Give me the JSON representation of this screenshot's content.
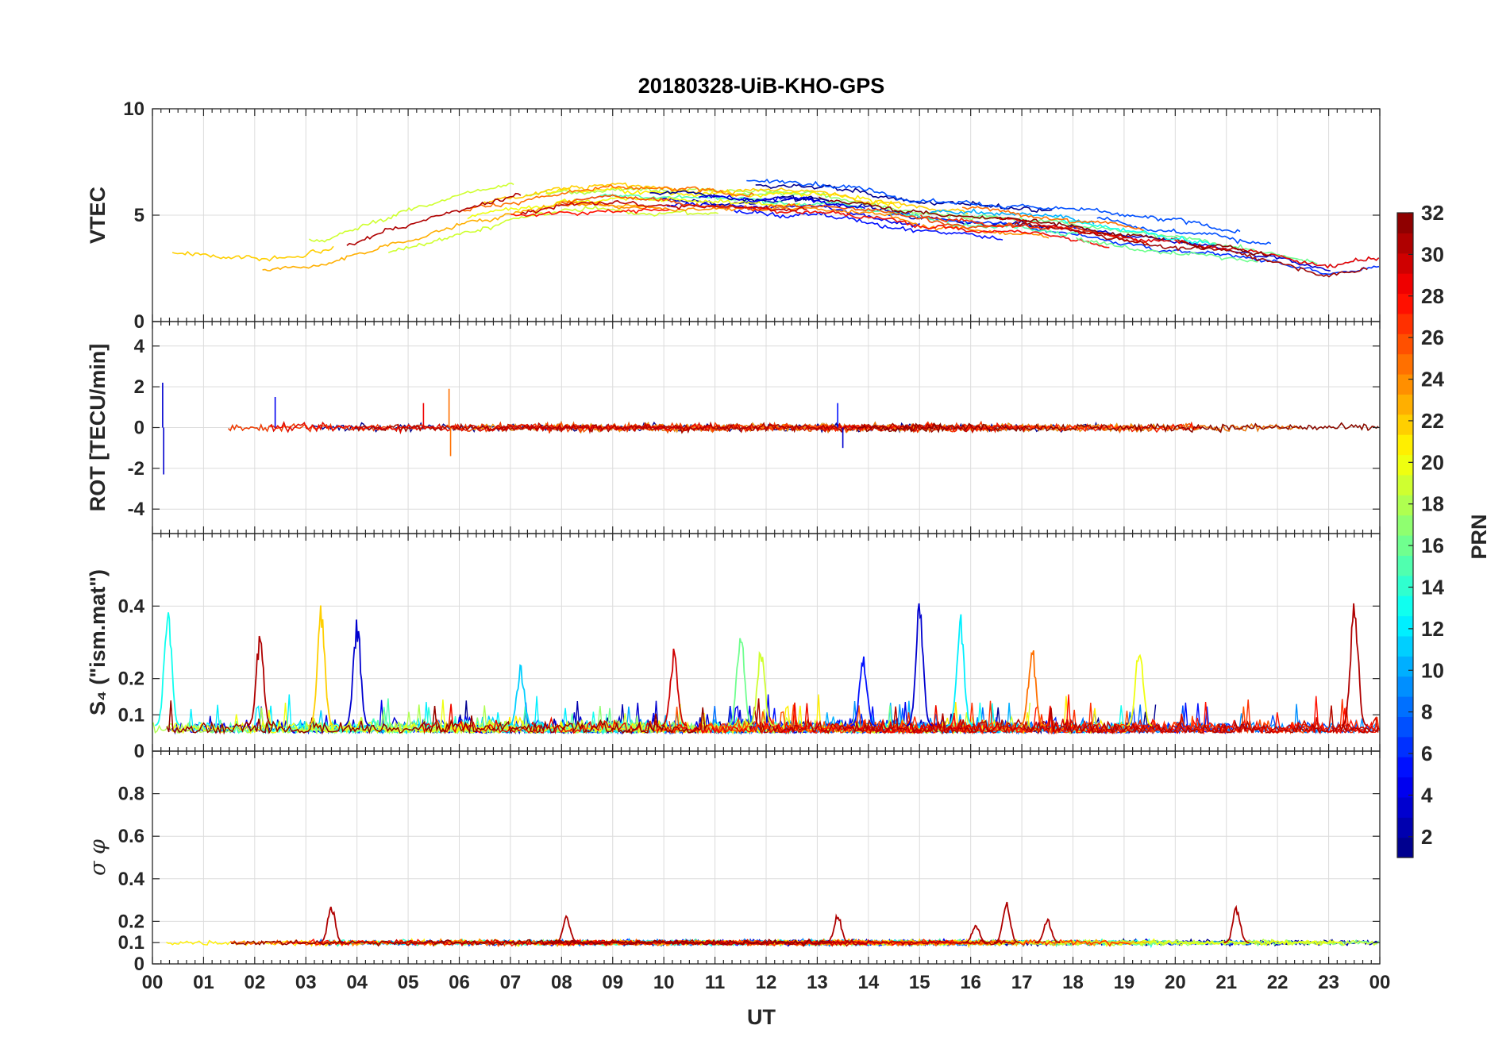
{
  "chart_data": {
    "type": "line",
    "title": "20180328-UiB-KHO-GPS",
    "xlabel": "UT",
    "x_ticks": [
      "00",
      "01",
      "02",
      "03",
      "04",
      "05",
      "06",
      "07",
      "08",
      "09",
      "10",
      "11",
      "12",
      "13",
      "14",
      "15",
      "16",
      "17",
      "18",
      "19",
      "20",
      "21",
      "22",
      "23",
      "00"
    ],
    "xlim": [
      0,
      24
    ],
    "panels": [
      {
        "id": "vtec",
        "ylabel": "VTEC",
        "ylim": [
          0,
          10
        ],
        "yticks": [
          0,
          5,
          10
        ],
        "grid": true,
        "trend_hours": [
          0,
          1,
          2,
          3,
          4,
          5,
          6,
          7,
          8,
          9,
          10,
          11,
          12,
          13,
          14,
          15,
          16,
          17,
          18,
          19,
          20,
          21,
          22,
          23,
          24
        ],
        "trend_values": [
          3.0,
          3.1,
          3.0,
          3.0,
          3.6,
          4.4,
          5.1,
          5.6,
          6.0,
          6.1,
          6.0,
          5.9,
          5.8,
          5.8,
          5.5,
          5.1,
          4.9,
          4.8,
          4.5,
          4.1,
          3.8,
          3.5,
          3.1,
          2.5,
          2.9
        ]
      },
      {
        "id": "rot",
        "ylabel": "ROT [TECU/min]",
        "ylim": [
          -5.2,
          5.2
        ],
        "yticks": [
          -4,
          -2,
          0,
          2,
          4
        ],
        "grid": true,
        "baseline": 0
      },
      {
        "id": "s4",
        "ylabel": "S₄ (\"ism.mat\")",
        "ylim": [
          0,
          0.6
        ],
        "yticks": [
          0,
          0.1,
          0.2,
          0.4
        ],
        "ytick_labels": [
          "0",
          "0.1",
          "0.2",
          "0.4"
        ],
        "grid": true,
        "baseline": 0.07,
        "peaks": [
          {
            "hour": 0.3,
            "value": 0.42,
            "prn": 13
          },
          {
            "hour": 2.1,
            "value": 0.33,
            "prn": 31
          },
          {
            "hour": 3.3,
            "value": 0.41,
            "prn": 22
          },
          {
            "hour": 4.0,
            "value": 0.38,
            "prn": 3
          },
          {
            "hour": 7.2,
            "value": 0.24,
            "prn": 11
          },
          {
            "hour": 10.2,
            "value": 0.29,
            "prn": 30
          },
          {
            "hour": 11.5,
            "value": 0.35,
            "prn": 16
          },
          {
            "hour": 11.9,
            "value": 0.3,
            "prn": 19
          },
          {
            "hour": 13.9,
            "value": 0.27,
            "prn": 5
          },
          {
            "hour": 15.0,
            "value": 0.43,
            "prn": 3
          },
          {
            "hour": 15.8,
            "value": 0.39,
            "prn": 12
          },
          {
            "hour": 17.2,
            "value": 0.3,
            "prn": 25
          },
          {
            "hour": 19.3,
            "value": 0.32,
            "prn": 20
          },
          {
            "hour": 23.5,
            "value": 0.46,
            "prn": 31
          }
        ]
      },
      {
        "id": "sigma_phi",
        "ylabel": "σ φ",
        "ylim": [
          0,
          1
        ],
        "yticks": [
          0,
          0.1,
          0.2,
          0.4,
          0.6,
          0.8
        ],
        "ytick_labels": [
          "0",
          "0.1",
          "0.2",
          "0.4",
          "0.6",
          "0.8"
        ],
        "grid": true,
        "baseline": 0.1,
        "peaks": [
          {
            "hour": 3.5,
            "value": 0.29,
            "prn": 31
          },
          {
            "hour": 8.1,
            "value": 0.23,
            "prn": 31
          },
          {
            "hour": 13.4,
            "value": 0.24,
            "prn": 31
          },
          {
            "hour": 16.1,
            "value": 0.19,
            "prn": 31
          },
          {
            "hour": 16.7,
            "value": 0.31,
            "prn": 31
          },
          {
            "hour": 17.5,
            "value": 0.22,
            "prn": 31
          },
          {
            "hour": 21.2,
            "value": 0.28,
            "prn": 31
          }
        ]
      }
    ],
    "colorbar": {
      "label": "PRN",
      "range": [
        1,
        32
      ],
      "ticks": [
        2,
        4,
        6,
        8,
        10,
        12,
        14,
        16,
        18,
        20,
        22,
        24,
        26,
        28,
        30,
        32
      ],
      "colormap": "jet",
      "levels": 32
    },
    "series_count": 32
  }
}
